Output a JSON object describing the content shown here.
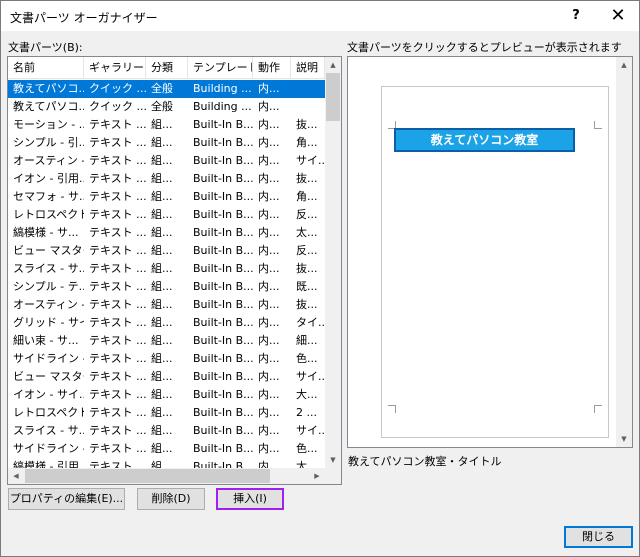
{
  "window": {
    "title": "文書パーツ オーガナイザー",
    "help_glyph": "?",
    "close_glyph": "✕"
  },
  "list": {
    "label": "文書パーツ(B):",
    "columns": [
      "名前",
      "ギャラリー",
      "分類",
      "テンプレート",
      "動作",
      "説明"
    ],
    "rows": [
      [
        "教えてパソコ...",
        "クイック ...",
        "全般",
        "Building ...",
        "内...",
        ""
      ],
      [
        "教えてパソコ...",
        "クイック ...",
        "全般",
        "Building ...",
        "内...",
        ""
      ],
      [
        "モーション - ...",
        "テキスト ...",
        "組...",
        "Built-In B...",
        "内...",
        "抜..."
      ],
      [
        "シンプル - 引...",
        "テキスト ...",
        "組...",
        "Built-In B...",
        "内...",
        "角..."
      ],
      [
        "オースティン - ...",
        "テキスト ...",
        "組...",
        "Built-In B...",
        "内...",
        "サイ..."
      ],
      [
        "イオン - 引用...",
        "テキスト ...",
        "組...",
        "Built-In B...",
        "内...",
        "抜..."
      ],
      [
        "セマフォ - サ...",
        "テキスト ...",
        "組...",
        "Built-In B...",
        "内...",
        "角..."
      ],
      [
        "レトロスペクト...",
        "テキスト ...",
        "組...",
        "Built-In B...",
        "内...",
        "反..."
      ],
      [
        "縞模様 - サ...",
        "テキスト ...",
        "組...",
        "Built-In B...",
        "内...",
        "太..."
      ],
      [
        "ビュー マスター...",
        "テキスト ...",
        "組...",
        "Built-In B...",
        "内...",
        "反..."
      ],
      [
        "スライス - サ...",
        "テキスト ...",
        "組...",
        "Built-In B...",
        "内...",
        "抜..."
      ],
      [
        "シンプル - テ...",
        "テキスト ...",
        "組...",
        "Built-In B...",
        "内...",
        "既..."
      ],
      [
        "オースティン - ...",
        "テキスト ...",
        "組...",
        "Built-In B...",
        "内...",
        "抜..."
      ],
      [
        "グリッド - サイ...",
        "テキスト ...",
        "組...",
        "Built-In B...",
        "内...",
        "タイ..."
      ],
      [
        "細い束 - サ...",
        "テキスト ...",
        "組...",
        "Built-In B...",
        "内...",
        "細..."
      ],
      [
        "サイドライン - ...",
        "テキスト ...",
        "組...",
        "Built-In B...",
        "内...",
        "色..."
      ],
      [
        "ビュー マスター...",
        "テキスト ...",
        "組...",
        "Built-In B...",
        "内...",
        "サイ..."
      ],
      [
        "イオン - サイ...",
        "テキスト ...",
        "組...",
        "Built-In B...",
        "内...",
        "大..."
      ],
      [
        "レトロスペクト...",
        "テキスト ...",
        "組...",
        "Built-In B...",
        "内...",
        "2 ..."
      ],
      [
        "スライス - サ...",
        "テキスト ...",
        "組...",
        "Built-In B...",
        "内...",
        "サイ..."
      ],
      [
        "サイドライン - ...",
        "テキスト ...",
        "組...",
        "Built-In B...",
        "内...",
        "色..."
      ],
      [
        "縞模様 - 引用...",
        "テキスト ...",
        "組...",
        "Built-In B...",
        "内...",
        "太..."
      ]
    ]
  },
  "preview": {
    "label": "文書パーツをクリックするとプレビューが表示されます",
    "block_text": "教えてパソコン教室",
    "caption": "教えてパソコン教室・タイトル"
  },
  "buttons": {
    "edit_properties": "プロパティの編集(E)...",
    "delete": "削除(D)",
    "insert": "挿入(I)",
    "close": "閉じる"
  },
  "scroll_glyphs": {
    "up": "▲",
    "down": "▼",
    "left": "◀",
    "right": "▶"
  },
  "colors": {
    "selection": "#0078d7",
    "insert_highlight": "#a020f0",
    "preview_block": "#1ca2e6"
  }
}
